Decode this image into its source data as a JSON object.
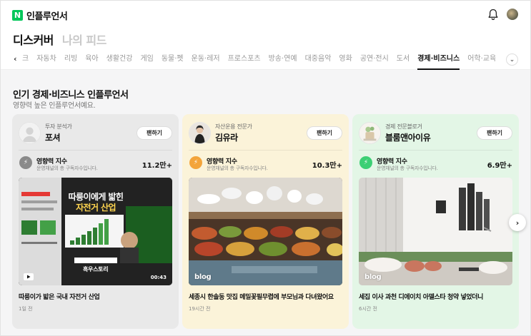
{
  "header": {
    "logo_badge": "N",
    "logo_text": "인플루언서"
  },
  "main_tabs": [
    {
      "label": "디스커버",
      "active": true
    },
    {
      "label": "나의 피드",
      "active": false
    }
  ],
  "categories": {
    "prev_partial": "크",
    "items": [
      "자동차",
      "리빙",
      "육아",
      "생활건강",
      "게임",
      "동물·펫",
      "운동·레저",
      "프로스포츠",
      "방송·연예",
      "대중음악",
      "영화",
      "공연·전시",
      "도서",
      "경제·비즈니스",
      "어학·교육"
    ],
    "active": "경제·비즈니스"
  },
  "section": {
    "title": "인기 경제·비즈니스 인플루언서",
    "subtitle": "영향력 높은 인플루언서예요."
  },
  "cards": [
    {
      "role": "투자 분석가",
      "name": "포셔",
      "follow_label": "팬하기",
      "influence_label": "영향력 지수",
      "influence_desc": "운영채널의 총 구독자수입니다.",
      "influence_value": "11.2만+",
      "thumb_text_1": "따릉이에게 밟힌",
      "thumb_text_2": "자전거 산업",
      "thumb_channel": "흑우스토리",
      "duration": "00:43",
      "post_title": "따릉이가 밟은 국내 자전거 산업",
      "post_time": "1일 전",
      "bg": "#e9e9e9"
    },
    {
      "role": "자산운용 전문가",
      "name": "김유라",
      "follow_label": "팬하기",
      "influence_label": "영향력 지수",
      "influence_desc": "운영채널의 총 구독자수입니다.",
      "influence_value": "10.3만+",
      "thumb_tag": "blog",
      "post_title": "세종시 한솔동 맛집 메밀꽃필무렵에 부모님과 다녀왔어요",
      "post_time": "19시간 전",
      "bg": "#fbf3d9"
    },
    {
      "role": "경제 전문블로거",
      "name": "블룸앤아이유",
      "follow_label": "팬하기",
      "influence_label": "영향력 지수",
      "influence_desc": "운영채널의 총 구독자수입니다.",
      "influence_value": "6.9만+",
      "thumb_tag": "blog",
      "post_title": "세집 이사 과천 디에이치 아델스타 청약 넣었더니",
      "post_time": "6시간 전",
      "bg": "#e3f6e6"
    }
  ],
  "colors": {
    "brand_green": "#03c75a",
    "influence_gray": "#8a8a8a",
    "influence_orange": "#f3a43b",
    "influence_green": "#3ccf74"
  },
  "icons": {
    "bell": "bell-icon",
    "next": "chevron-right-icon",
    "category_more": "chevron-down-icon"
  }
}
